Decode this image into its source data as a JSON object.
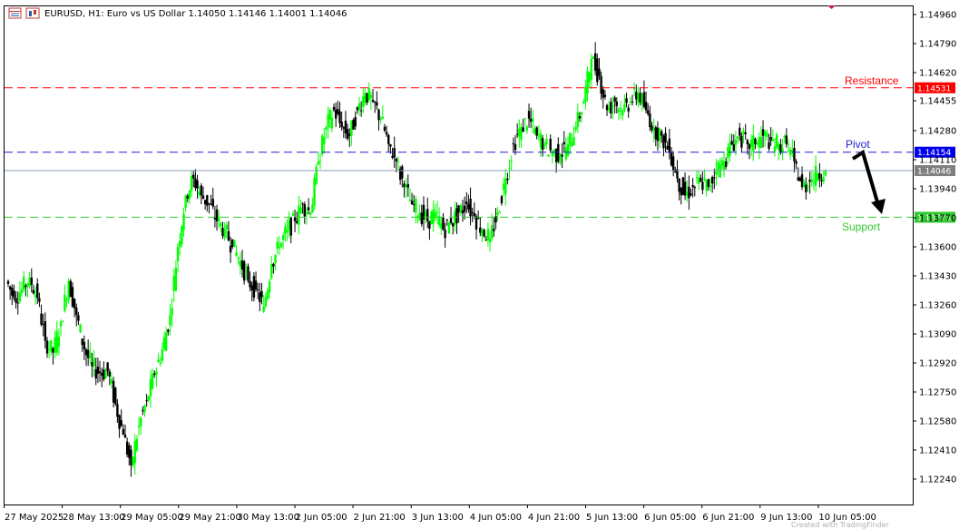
{
  "header": {
    "symbol_text": "EURUSD, H1:  Euro vs US Dollar  1.14050 1.14146 1.14001 1.14046",
    "icons": [
      "window-grid-icon",
      "chart-type-icon"
    ]
  },
  "colors": {
    "bull": "#00ff00",
    "bear": "#000000",
    "resistance": "#ff0000",
    "pivot": "#1f1fd1",
    "support": "#2ecc2e",
    "current_line": "#8a9db5",
    "arrow": "#000000",
    "resistance_tag_bg": "#ff0000",
    "pivot_tag_bg": "#0000ee",
    "current_tag_bg": "#7f7f7f",
    "support_tag_bg": "#2ecc2e"
  },
  "chart_data": {
    "type": "candlestick",
    "symbol": "EURUSD",
    "timeframe": "H1",
    "ylim": [
      1.1215,
      1.1503
    ],
    "y_ticks": [
      "1.14960",
      "1.14790",
      "1.14620",
      "1.14455",
      "1.14280",
      "1.14110",
      "1.13940",
      "1.13770",
      "1.13600",
      "1.13430",
      "1.13260",
      "1.13090",
      "1.12920",
      "1.12750",
      "1.12580",
      "1.12410",
      "1.12240"
    ],
    "x_ticks": [
      "27 May 2025",
      "28 May 13:00",
      "29 May 05:00",
      "29 May 21:00",
      "30 May 13:00",
      "2 Jun 05:00",
      "2 Jun 21:00",
      "3 Jun 13:00",
      "4 Jun 05:00",
      "4 Jun 21:00",
      "5 Jun 13:00",
      "6 Jun 05:00",
      "6 Jun 21:00",
      "9 Jun 13:00",
      "10 Jun 05:00"
    ],
    "levels": [
      {
        "name": "Resistance",
        "value": 1.14531,
        "value_text": "1.14531",
        "style": "dashed"
      },
      {
        "name": "Pivot",
        "value": 1.14154,
        "value_text": "1.14154",
        "style": "dashed"
      },
      {
        "name": "Support",
        "value": 1.13773,
        "value_text": "1.13773",
        "style": "dashed"
      }
    ],
    "current_price": {
      "value": 1.14046,
      "value_text": "1.14046"
    },
    "ohlc_last": {
      "open": 1.1405,
      "high": 1.14146,
      "low": 1.14001,
      "close": 1.14046
    },
    "price_path": [
      1.134,
      1.133,
      1.1335,
      1.1342,
      1.133,
      1.1305,
      1.1298,
      1.1316,
      1.134,
      1.132,
      1.13,
      1.129,
      1.1286,
      1.1287,
      1.1268,
      1.125,
      1.1232,
      1.1255,
      1.127,
      1.1285,
      1.13,
      1.132,
      1.136,
      1.139,
      1.14,
      1.139,
      1.1385,
      1.1375,
      1.137,
      1.136,
      1.1352,
      1.134,
      1.1335,
      1.1325,
      1.135,
      1.136,
      1.137,
      1.1375,
      1.1385,
      1.138,
      1.141,
      1.143,
      1.144,
      1.143,
      1.1425,
      1.144,
      1.145,
      1.1445,
      1.1435,
      1.142,
      1.141,
      1.1395,
      1.1385,
      1.138,
      1.1375,
      1.138,
      1.137,
      1.1374,
      1.138,
      1.1385,
      1.1378,
      1.137,
      1.1365,
      1.138,
      1.14,
      1.142,
      1.143,
      1.1435,
      1.1425,
      1.142,
      1.1415,
      1.1414,
      1.142,
      1.143,
      1.1445,
      1.147,
      1.146,
      1.144,
      1.1445,
      1.144,
      1.1445,
      1.145,
      1.144,
      1.143,
      1.1425,
      1.1415,
      1.14,
      1.139,
      1.1395,
      1.1398,
      1.1395,
      1.1405,
      1.141,
      1.142,
      1.1425,
      1.142,
      1.142,
      1.1425,
      1.1422,
      1.142,
      1.142,
      1.141,
      1.1395,
      1.1398,
      1.1403,
      1.1405
    ]
  },
  "annotations": {
    "resistance_label": "Resistance",
    "pivot_label": "Pivot",
    "support_label": "Support"
  },
  "watermark": "Created with TradingFinder"
}
